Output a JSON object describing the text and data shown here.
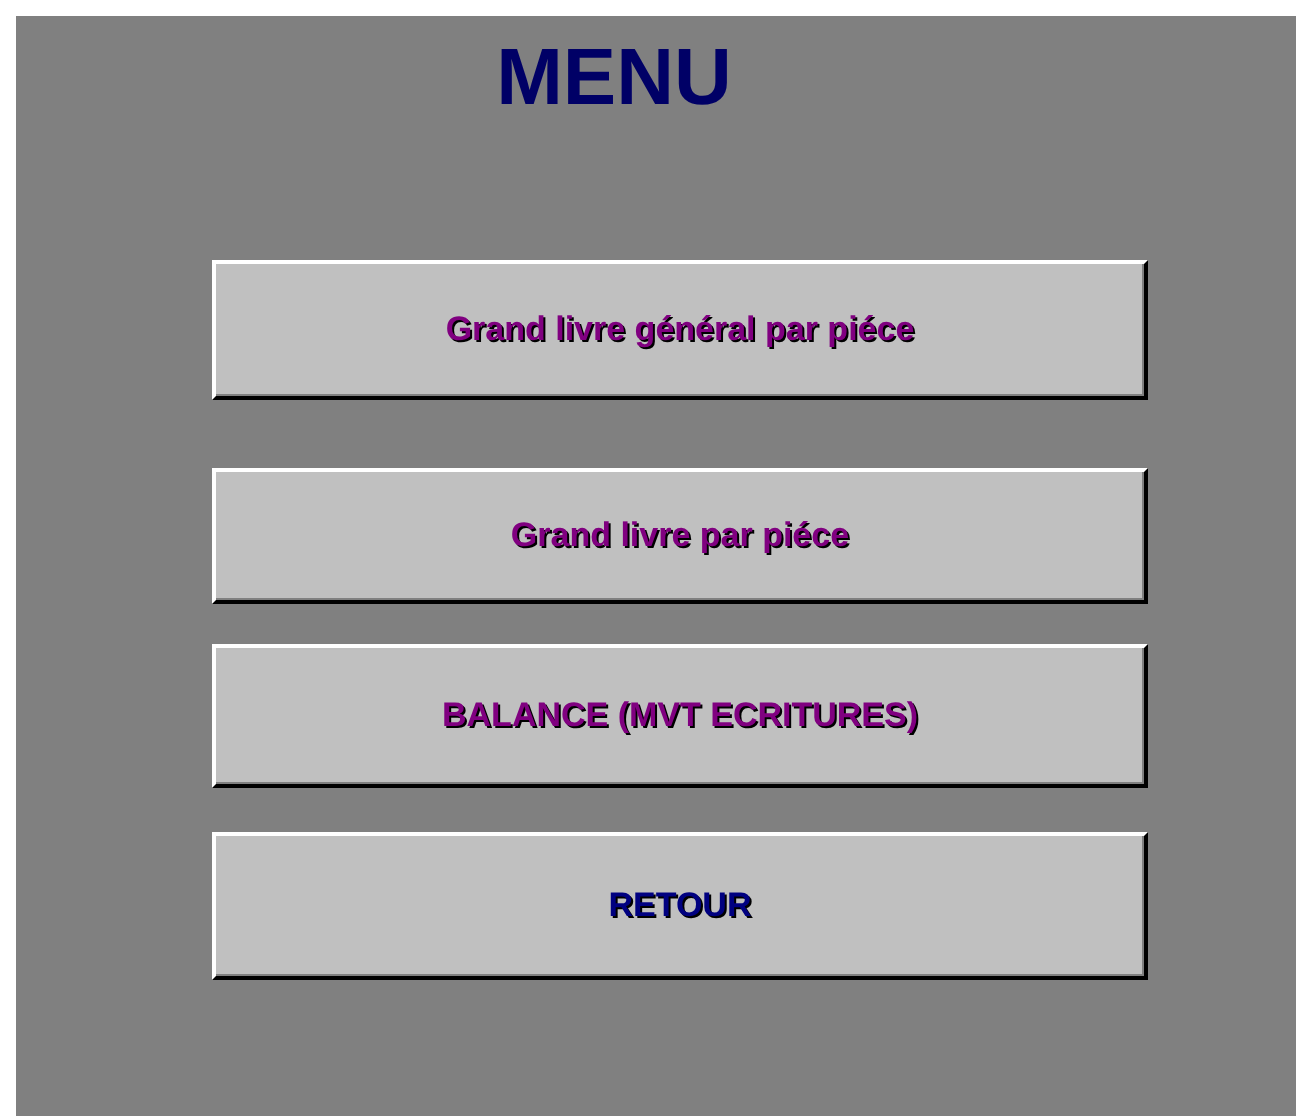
{
  "title": "MENU",
  "buttons": [
    {
      "label": "Grand livre général par piéce",
      "color": "#800080"
    },
    {
      "label": "Grand livre par piéce",
      "color": "#800080"
    },
    {
      "label": "BALANCE (MVT ECRITURES)",
      "color": "#800080"
    },
    {
      "label": "RETOUR",
      "color": "#000080"
    }
  ]
}
